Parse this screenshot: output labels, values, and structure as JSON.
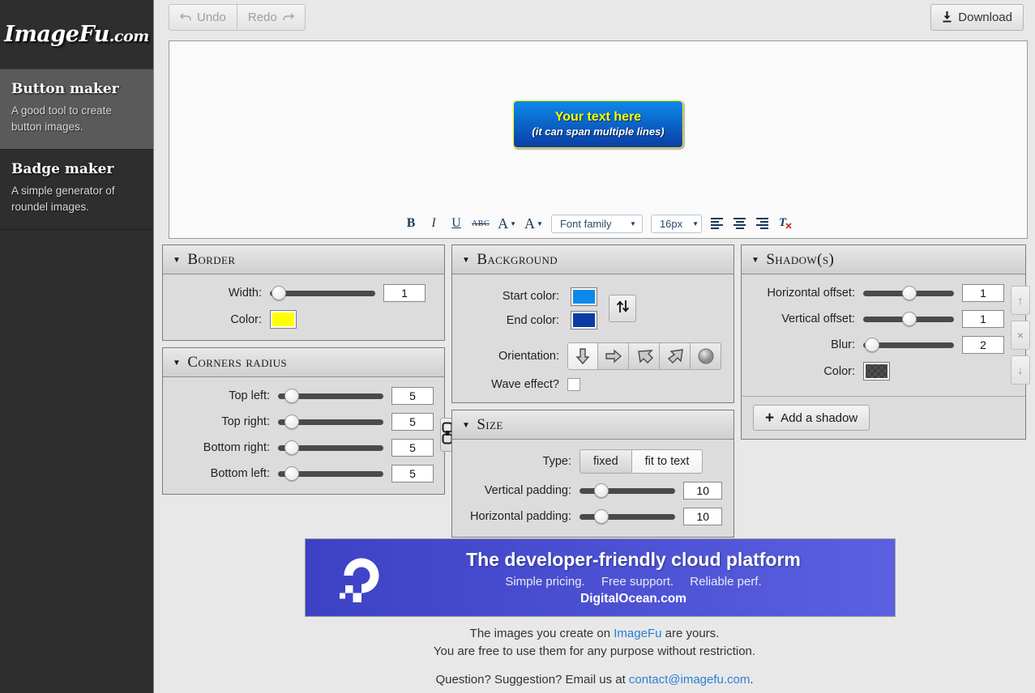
{
  "sidebar": {
    "logo_main": "ImageFu",
    "logo_tld": ".com",
    "items": [
      {
        "title": "Button maker",
        "desc": "A good tool to create button images."
      },
      {
        "title": "Badge maker",
        "desc": "A simple generator of roundel images."
      }
    ]
  },
  "toolbar": {
    "undo_label": "Undo",
    "redo_label": "Redo",
    "download_label": "Download",
    "undo_icon": "undo-arrow-icon",
    "redo_icon": "redo-arrow-icon",
    "download_icon": "download-arrow-icon"
  },
  "preview": {
    "line1": "Your text here",
    "line2": "(it can span multiple lines)"
  },
  "text_toolbar": {
    "bold": "B",
    "italic": "I",
    "underline": "U",
    "strikethrough": "ABC",
    "font_color_glyph": "A",
    "highlight_color_glyph": "A",
    "font_family_value": "Font family",
    "font_size_value": "16px",
    "clear_format_glyph": "T",
    "caret": "▼"
  },
  "panels": {
    "border": {
      "title": "Border",
      "caret": "▼",
      "width_label": "Width:",
      "width_value": "1",
      "color_label": "Color:",
      "color_value": "#ffff00"
    },
    "corners": {
      "title": "Corners radius",
      "caret": "▼",
      "rows": [
        {
          "label": "Top left:",
          "value": "5"
        },
        {
          "label": "Top right:",
          "value": "5"
        },
        {
          "label": "Bottom right:",
          "value": "5"
        },
        {
          "label": "Bottom left:",
          "value": "5"
        }
      ],
      "link_icon": "link-corners-icon"
    },
    "background": {
      "title": "Background",
      "caret": "▼",
      "start_label": "Start color:",
      "start_value": "#0c8ae9",
      "end_label": "End color:",
      "end_value": "#0a3da6",
      "swap_icon": "swap-vertical-icon",
      "orientation_label": "Orientation:",
      "orientations": [
        {
          "name": "orientation-down",
          "selected": true
        },
        {
          "name": "orientation-right",
          "selected": false
        },
        {
          "name": "orientation-diagonal-down-right",
          "selected": false
        },
        {
          "name": "orientation-diagonal-up-right",
          "selected": false
        },
        {
          "name": "orientation-radial",
          "selected": false
        }
      ],
      "wave_label": "Wave effect?",
      "wave_checked": false
    },
    "size": {
      "title": "Size",
      "caret": "▼",
      "type_label": "Type:",
      "type_fixed": "fixed",
      "type_fit": "fit to text",
      "type_selected": "fit to text",
      "vpad_label": "Vertical padding:",
      "vpad_value": "10",
      "hpad_label": "Horizontal padding:",
      "hpad_value": "10"
    },
    "shadow": {
      "title": "Shadow(s)",
      "caret": "▼",
      "hoffset_label": "Horizontal offset:",
      "hoffset_value": "1",
      "voffset_label": "Vertical offset:",
      "voffset_value": "1",
      "blur_label": "Blur:",
      "blur_value": "2",
      "color_label": "Color:",
      "move_up_glyph": "↑",
      "remove_glyph": "×",
      "move_down_glyph": "↓",
      "add_plus": "+",
      "add_label": "Add a shadow"
    }
  },
  "ad": {
    "headline": "The developer-friendly cloud platform",
    "sub1": "Simple pricing.",
    "sub2": "Free support.",
    "sub3": "Reliable perf.",
    "link": "DigitalOcean.com",
    "logo_icon": "digitalocean-logo-icon"
  },
  "footer": {
    "line1_a": "The images you create on ",
    "line1_link": "ImageFu",
    "line1_b": " are yours.",
    "line2": "You are free to use them for any purpose without restriction.",
    "line3_a": "Question? Suggestion? Email us at ",
    "line3_link": "contact@imagefu.com",
    "line3_b": "."
  }
}
